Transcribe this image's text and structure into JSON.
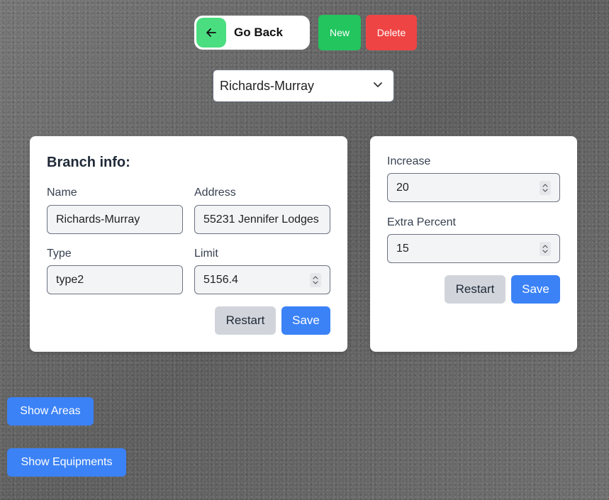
{
  "topbar": {
    "go_back_label": "Go Back",
    "new_label": "New",
    "delete_label": "Delete"
  },
  "branch_select": {
    "selected": "Richards-Murray"
  },
  "branch_info": {
    "title": "Branch info:",
    "name_label": "Name",
    "name_value": "Richards-Murray",
    "address_label": "Address",
    "address_value": "55231 Jennifer Lodges",
    "type_label": "Type",
    "type_value": "type2",
    "limit_label": "Limit",
    "limit_value": "5156.4",
    "restart_label": "Restart",
    "save_label": "Save"
  },
  "increase_card": {
    "increase_label": "Increase",
    "increase_value": "20",
    "extra_percent_label": "Extra Percent",
    "extra_percent_value": "15",
    "restart_label": "Restart",
    "save_label": "Save"
  },
  "bottom": {
    "show_areas_label": "Show Areas",
    "show_equipments_label": "Show Equipments"
  },
  "colors": {
    "green_button": "#22c55e",
    "go_back_icon_bg": "#4ade80",
    "red_button": "#ef4444",
    "blue_button": "#3b82f6",
    "gray_button": "#d1d5db"
  },
  "icons": {
    "go_back": "arrow-left-icon",
    "select": "chevron-down-icon",
    "number_spinner": "spinner-icon"
  }
}
